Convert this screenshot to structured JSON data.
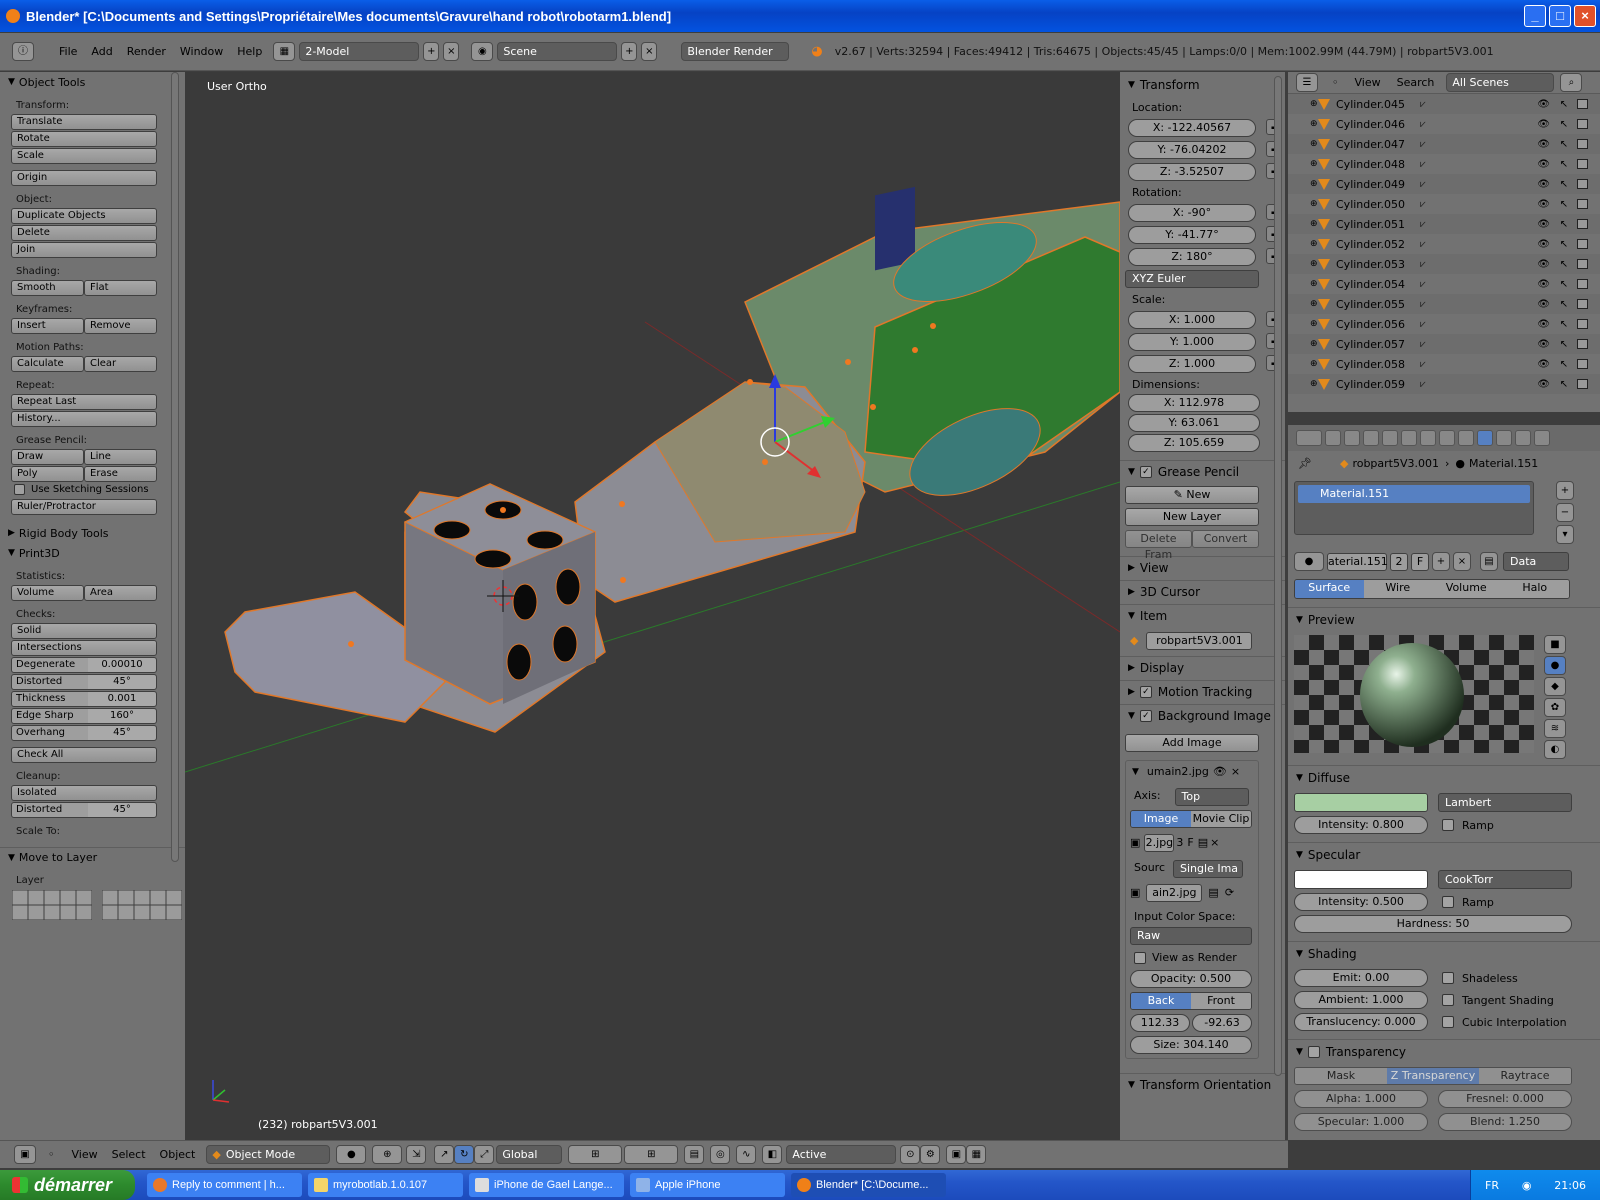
{
  "window": {
    "title": "Blender* [C:\\Documents and Settings\\Propriétaire\\Mes documents\\Gravure\\hand robot\\robotarm1.blend]"
  },
  "header": {
    "menus": [
      "File",
      "Add",
      "Render",
      "Window",
      "Help"
    ],
    "screen_layout": "2-Model",
    "scene": "Scene",
    "render_engine": "Blender Render",
    "stats": "v2.67 | Verts:32594 | Faces:49412 | Tris:64675 | Objects:45/45 | Lamps:0/0 | Mem:1002.99M (44.79M) | robpart5V3.001"
  },
  "tool_shelf": {
    "object_tools": "Object Tools",
    "transform_label": "Transform:",
    "translate": "Translate",
    "rotate": "Rotate",
    "scale": "Scale",
    "origin": "Origin",
    "object_label": "Object:",
    "duplicate": "Duplicate Objects",
    "delete": "Delete",
    "join": "Join",
    "shading_label": "Shading:",
    "smooth": "Smooth",
    "flat": "Flat",
    "keyframes_label": "Keyframes:",
    "insert": "Insert",
    "remove": "Remove",
    "motion_paths_label": "Motion Paths:",
    "calculate": "Calculate",
    "clear": "Clear",
    "repeat_label": "Repeat:",
    "repeat_last": "Repeat Last",
    "history": "History...",
    "grease_label": "Grease Pencil:",
    "draw": "Draw",
    "line": "Line",
    "poly": "Poly",
    "erase": "Erase",
    "use_sketching": "Use Sketching Sessions",
    "ruler": "Ruler/Protractor",
    "rigid_body": "Rigid Body Tools",
    "print3d": "Print3D",
    "statistics_label": "Statistics:",
    "volume": "Volume",
    "area": "Area",
    "checks_label": "Checks:",
    "solid": "Solid",
    "intersections": "Intersections",
    "degenerate": {
      "label": "Degenerate",
      "value": "0.00010"
    },
    "distorted": {
      "label": "Distorted",
      "value": "45°"
    },
    "thickness": {
      "label": "Thickness",
      "value": "0.001"
    },
    "edge_sharp": {
      "label": "Edge Sharp",
      "value": "160°"
    },
    "overhang": {
      "label": "Overhang",
      "value": "45°"
    },
    "check_all": "Check All",
    "cleanup_label": "Cleanup:",
    "isolated": "Isolated",
    "distorted2": {
      "label": "Distorted",
      "value": "45°"
    },
    "scale_to_label": "Scale To:",
    "move_to_layer": "Move to Layer",
    "layer_label": "Layer"
  },
  "viewport": {
    "view_label": "User Ortho",
    "object_label": "(232) robpart5V3.001"
  },
  "n_panel": {
    "transform": "Transform",
    "location_label": "Location:",
    "location": [
      "X: -122.40567",
      "Y: -76.04202",
      "Z: -3.52507"
    ],
    "rotation_label": "Rotation:",
    "rotation": [
      "X: -90°",
      "Y: -41.77°",
      "Z: 180°"
    ],
    "rotation_mode": "XYZ Euler",
    "scale_label": "Scale:",
    "scale": [
      "X: 1.000",
      "Y: 1.000",
      "Z: 1.000"
    ],
    "dimensions_label": "Dimensions:",
    "dimensions": [
      "X: 112.978",
      "Y: 63.061",
      "Z: 105.659"
    ],
    "grease_pencil": "Grease Pencil",
    "new": "New",
    "new_layer": "New Layer",
    "delete_frame": "Delete Fram",
    "convert": "Convert",
    "view": "View",
    "cursor": "3D Cursor",
    "item": "Item",
    "item_name": "robpart5V3.001",
    "display": "Display",
    "motion_tracking": "Motion Tracking",
    "background_images": "Background Image",
    "add_image": "Add Image",
    "bg_file": "umain2.jpg",
    "axis_label": "Axis:",
    "axis": "Top",
    "image": "Image",
    "movie_clip": "Movie Clip",
    "img_field": "2.jpg",
    "img_users": "3",
    "img_f": "F",
    "source_label": "Sourc",
    "source": "Single Ima",
    "img_file": "ain2.jpg",
    "color_space_label": "Input Color Space:",
    "color_space": "Raw",
    "view_as_render": "View as Render",
    "opacity": "Opacity: 0.500",
    "back": "Back",
    "front": "Front",
    "offset_x": "112.33",
    "offset_y": "-92.63",
    "size": "Size: 304.140",
    "transform_orientation": "Transform Orientation"
  },
  "outliner": {
    "view": "View",
    "search": "Search",
    "display_mode": "All Scenes",
    "items": [
      "Cylinder.045",
      "Cylinder.046",
      "Cylinder.047",
      "Cylinder.048",
      "Cylinder.049",
      "Cylinder.050",
      "Cylinder.051",
      "Cylinder.052",
      "Cylinder.053",
      "Cylinder.054",
      "Cylinder.055",
      "Cylinder.056",
      "Cylinder.057",
      "Cylinder.058",
      "Cylinder.059"
    ]
  },
  "properties": {
    "object_name": "robpart5V3.001",
    "material_name": "Material.151",
    "slot": "Material.151",
    "mat_field": "aterial.151",
    "mat_users": "2",
    "mat_f": "F",
    "link": "Data",
    "tabs": [
      "Surface",
      "Wire",
      "Volume",
      "Halo"
    ],
    "preview": "Preview",
    "diffuse": "Diffuse",
    "diffuse_color": "#a7cfa3",
    "diffuse_shader": "Lambert",
    "diffuse_intensity": "Intensity: 0.800",
    "ramp": "Ramp",
    "specular": "Specular",
    "specular_color": "#ffffff",
    "specular_shader": "CookTorr",
    "specular_intensity": "Intensity: 0.500",
    "ramp2": "Ramp",
    "hardness": "Hardness: 50",
    "shading": "Shading",
    "emit": "Emit: 0.00",
    "shadeless": "Shadeless",
    "ambient": "Ambient: 1.000",
    "tangent": "Tangent Shading",
    "translucency": "Translucency: 0.000",
    "cubic": "Cubic Interpolation",
    "transparency": "Transparency",
    "mask": "Mask",
    "ztransp": "Z Transparency",
    "raytrace": "Raytrace",
    "alpha": "Alpha: 1.000",
    "fresnel": "Fresnel: 0.000",
    "specular2": "Specular: 1.000",
    "blend": "Blend: 1.250"
  },
  "view_header": {
    "menus": [
      "View",
      "Select",
      "Object"
    ],
    "mode": "Object Mode",
    "orientation": "Global",
    "pivot": "Active"
  },
  "taskbar": {
    "start": "démarrer",
    "tasks": [
      "Reply to comment | h...",
      "myrobotlab.1.0.107",
      "iPhone de Gael Lange...",
      "Apple iPhone",
      "Blender* [C:\\Docume..."
    ],
    "lang": "FR",
    "time": "21:06"
  }
}
